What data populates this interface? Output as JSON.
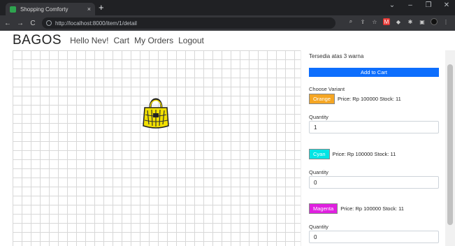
{
  "browser": {
    "tab_title": "Shopping Comforty",
    "tab_close": "×",
    "new_tab": "+",
    "url": "http://localhost:8000/item/1/detail",
    "window_controls": [
      "⌄",
      "–",
      "❐",
      "✕"
    ],
    "nav": {
      "back": "←",
      "forward": "→",
      "reload": "C"
    }
  },
  "navbar": {
    "brand": "BAGOS",
    "links": [
      "Hello Nev!",
      "Cart",
      "My Orders",
      "Logout"
    ]
  },
  "product": {
    "description": "Tersedia atas 3 warna",
    "add_to_cart": "Add to Cart",
    "choose_variant": "Choose Variant",
    "variants": [
      {
        "name": "Orange",
        "color": "#f5a623",
        "info": "Price: Rp 100000 Stock: 11",
        "qty_label": "Quantity",
        "qty": "1"
      },
      {
        "name": "Cyan",
        "color": "#00e5e5",
        "info": "Price: Rp 100000 Stock: 11",
        "qty_label": "Quantity",
        "qty": "0"
      },
      {
        "name": "Magenta",
        "color": "#e020e0",
        "info": "Price: Rp 100000 Stock: 11",
        "qty_label": "Quantity",
        "qty": "0"
      }
    ]
  },
  "colors": {
    "primary": "#0d6efd",
    "chrome_dark": "#202124"
  }
}
